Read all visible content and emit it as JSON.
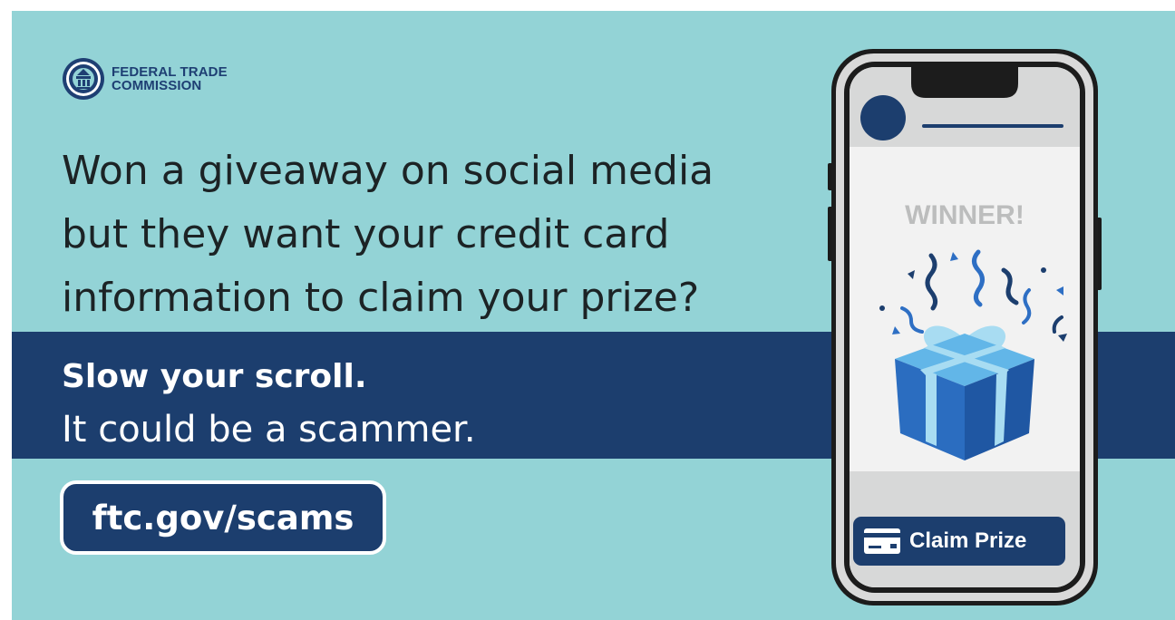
{
  "brand": {
    "line1": "FEDERAL TRADE",
    "line2": "COMMISSION"
  },
  "headline": [
    "Won a giveaway on social media",
    "but they want your credit card",
    "information to claim your prize?"
  ],
  "band": {
    "line1": "Slow your scroll.",
    "line2": "It could be a scammer."
  },
  "cta_url": "ftc.gov/scams",
  "phone": {
    "banner": "WINNER!",
    "button_label": "Claim Prize"
  },
  "colors": {
    "background": "#93d3d6",
    "navy": "#1c3e6e",
    "text_dark": "#1c2325",
    "gift_blue": "#2e6fc4",
    "ribbon": "#a8dcf2"
  }
}
